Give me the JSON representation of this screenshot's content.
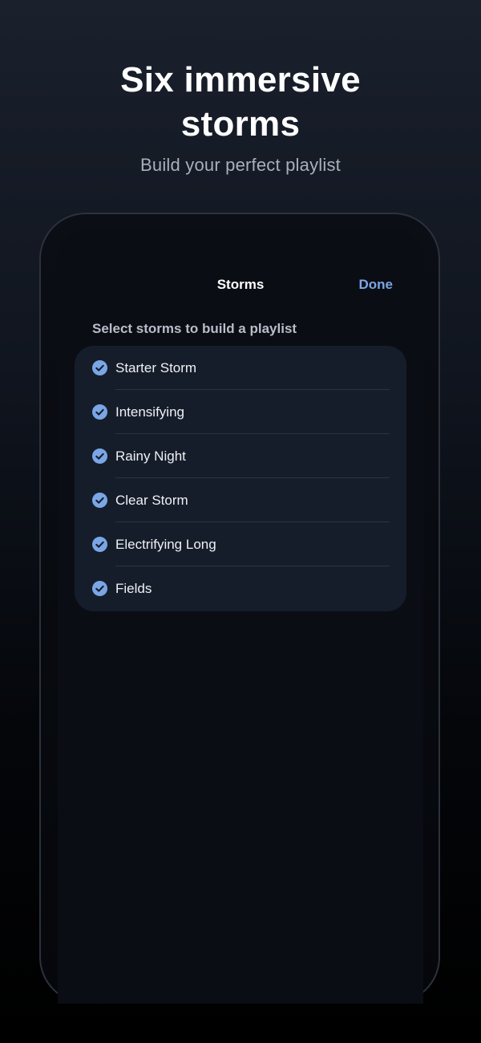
{
  "promo": {
    "headline_line1": "Six immersive",
    "headline_line2": "storms",
    "subheadline": "Build your perfect playlist"
  },
  "nav": {
    "title": "Storms",
    "done_label": "Done"
  },
  "section": {
    "header": "Select storms to build a playlist"
  },
  "storms": [
    {
      "label": "Starter Storm",
      "selected": true
    },
    {
      "label": "Intensifying",
      "selected": true
    },
    {
      "label": "Rainy Night",
      "selected": true
    },
    {
      "label": "Clear Storm",
      "selected": true
    },
    {
      "label": "Electrifying Long",
      "selected": true
    },
    {
      "label": "Fields",
      "selected": true
    }
  ],
  "colors": {
    "accent": "#7aa6e6",
    "list_background": "#161d2a",
    "checkmark_fill": "#7aa6e6"
  },
  "icons": {
    "checkmark": "checkmark-circle-icon"
  }
}
